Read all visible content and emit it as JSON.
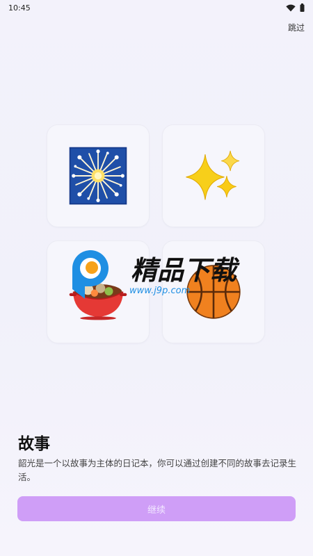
{
  "status_bar": {
    "time": "10:45",
    "icons": [
      "wifi-icon",
      "battery-icon"
    ]
  },
  "header": {
    "skip_label": "跳过"
  },
  "tiles": [
    {
      "icon": "fireworks-icon"
    },
    {
      "icon": "sparkles-icon"
    },
    {
      "icon": "pot-of-food-icon"
    },
    {
      "icon": "basketball-icon"
    }
  ],
  "watermark": {
    "brand": "精品下载",
    "url": "www.j9p.com"
  },
  "content": {
    "title": "故事",
    "description": "韶光是一个以故事为主体的日记本，你可以通过创建不同的故事去记录生活。"
  },
  "actions": {
    "continue_label": "继续"
  },
  "colors": {
    "accent": "#cf9ef7",
    "background": "#f2f1fa"
  }
}
